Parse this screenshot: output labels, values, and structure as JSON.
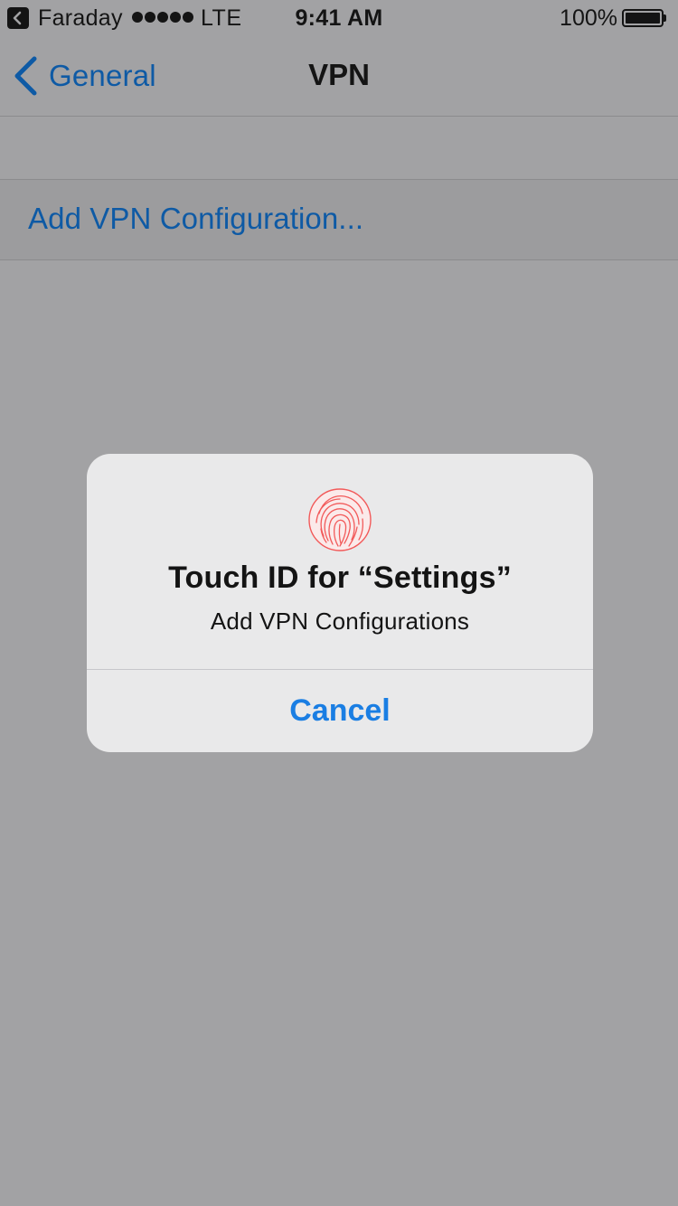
{
  "status_bar": {
    "carrier": "Faraday",
    "network": "LTE",
    "time": "9:41 AM",
    "battery_percent": "100%",
    "signal_bars": 5,
    "battery_level": 1.0,
    "icons": [
      "back-to-app-icon",
      "signal-icon",
      "battery-icon"
    ]
  },
  "nav": {
    "back_label": "General",
    "title": "VPN",
    "back_icon": "chevron-left-icon"
  },
  "table": {
    "add_vpn_label": "Add VPN Configuration..."
  },
  "alert": {
    "icon": "fingerprint-icon",
    "title": "Touch ID for “Settings”",
    "message": "Add VPN Configurations",
    "cancel_label": "Cancel"
  },
  "colors": {
    "link": "#0e5aa5",
    "alert_action": "#1a7ee3",
    "fingerprint": "#f25a5a",
    "dimmed_background": "#a2a2a4",
    "alert_background": "#e9e9ea"
  }
}
